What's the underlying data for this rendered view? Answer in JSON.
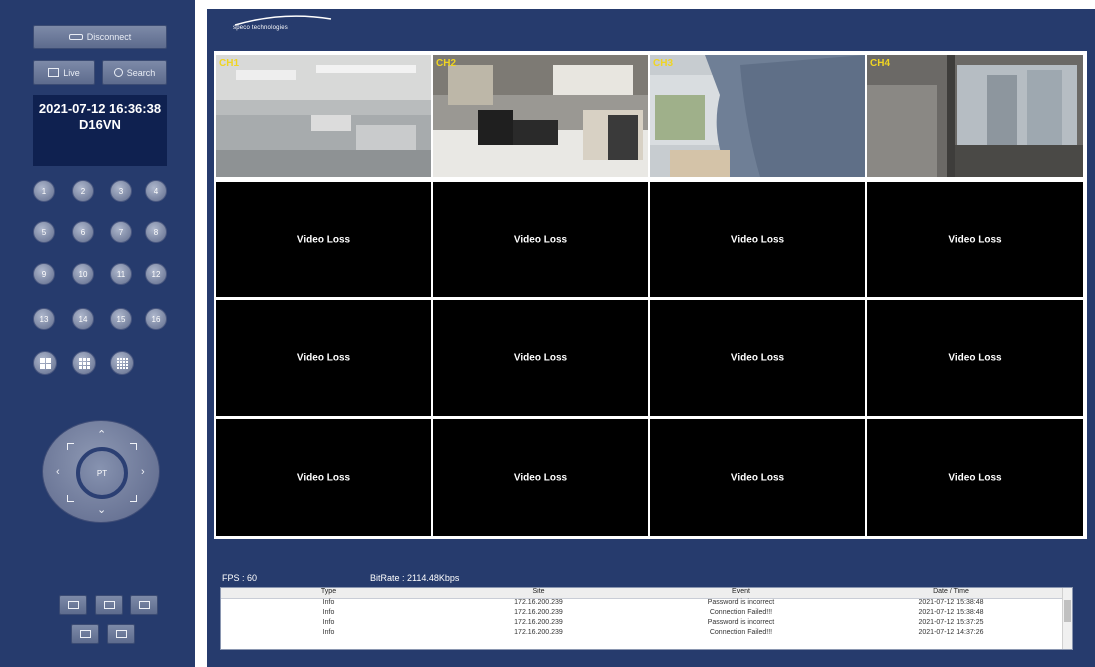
{
  "sidebar": {
    "disconnect_label": "Disconnect",
    "live_label": "Live",
    "search_label": "Search",
    "datetime": "2021-07-12 16:36:38",
    "device_name": "D16VN",
    "channels": [
      "1",
      "2",
      "3",
      "4",
      "5",
      "6",
      "7",
      "8",
      "9",
      "10",
      "11",
      "12",
      "13",
      "14",
      "15",
      "16"
    ],
    "layouts": [
      "2x2-grid-icon",
      "3x3-grid-icon",
      "4x4-grid-icon"
    ],
    "ptz_label": "PT"
  },
  "header": {
    "logo_text": "speco technologies"
  },
  "video_wall": {
    "cameras": [
      {
        "label": "CH1"
      },
      {
        "label": "CH2"
      },
      {
        "label": "CH3"
      },
      {
        "label": "CH4"
      }
    ],
    "video_loss_text": "Video Loss"
  },
  "stats": {
    "fps": "FPS : 60",
    "bitrate": "BitRate : 2114.48Kbps"
  },
  "log": {
    "columns": [
      "Type",
      "Site",
      "Event",
      "Date / Time"
    ],
    "rows": [
      {
        "type": "Info",
        "site": "172.16.200.239",
        "event": "Password is incorrect",
        "date": "2021-07-12 15:38:48"
      },
      {
        "type": "Info",
        "site": "172.16.200.239",
        "event": "Connection Failed!!!",
        "date": "2021-07-12 15:38:48"
      },
      {
        "type": "Info",
        "site": "172.16.200.239",
        "event": "Password is incorrect",
        "date": "2021-07-12 15:37:25"
      },
      {
        "type": "Info",
        "site": "172.16.200.239",
        "event": "Connection Failed!!!",
        "date": "2021-07-12 14:37:26"
      }
    ]
  },
  "colors": {
    "panel_bg": "#263b6d",
    "channel_label": "#f0d522"
  }
}
